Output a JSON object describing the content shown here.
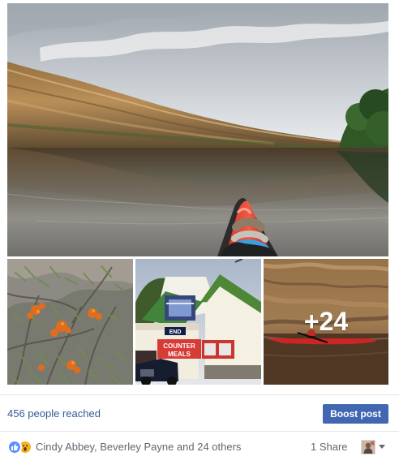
{
  "post": {
    "photos": [
      {
        "kind": "kayak-river-cliffs"
      },
      {
        "kind": "orange-flowering-shrub"
      },
      {
        "kind": "counter-meals-building"
      },
      {
        "kind": "red-kayak-cliff",
        "overlay": "+24"
      }
    ],
    "sign_text": [
      "END",
      "COUNTER",
      "MEALS"
    ]
  },
  "stats": {
    "reach_text": "456 people reached",
    "boost_label": "Boost post"
  },
  "reactions": {
    "icons": [
      "like-icon",
      "wow-icon"
    ],
    "summary": "Cindy Abbey, Beverley Payne and 24 others",
    "share_text": "1 Share"
  },
  "colors": {
    "facebook_blue": "#4267b2",
    "link_blue": "#365899",
    "secondary_text": "#616770",
    "like_blue": "#5890ff",
    "wow_yellow": "#f7b125"
  }
}
